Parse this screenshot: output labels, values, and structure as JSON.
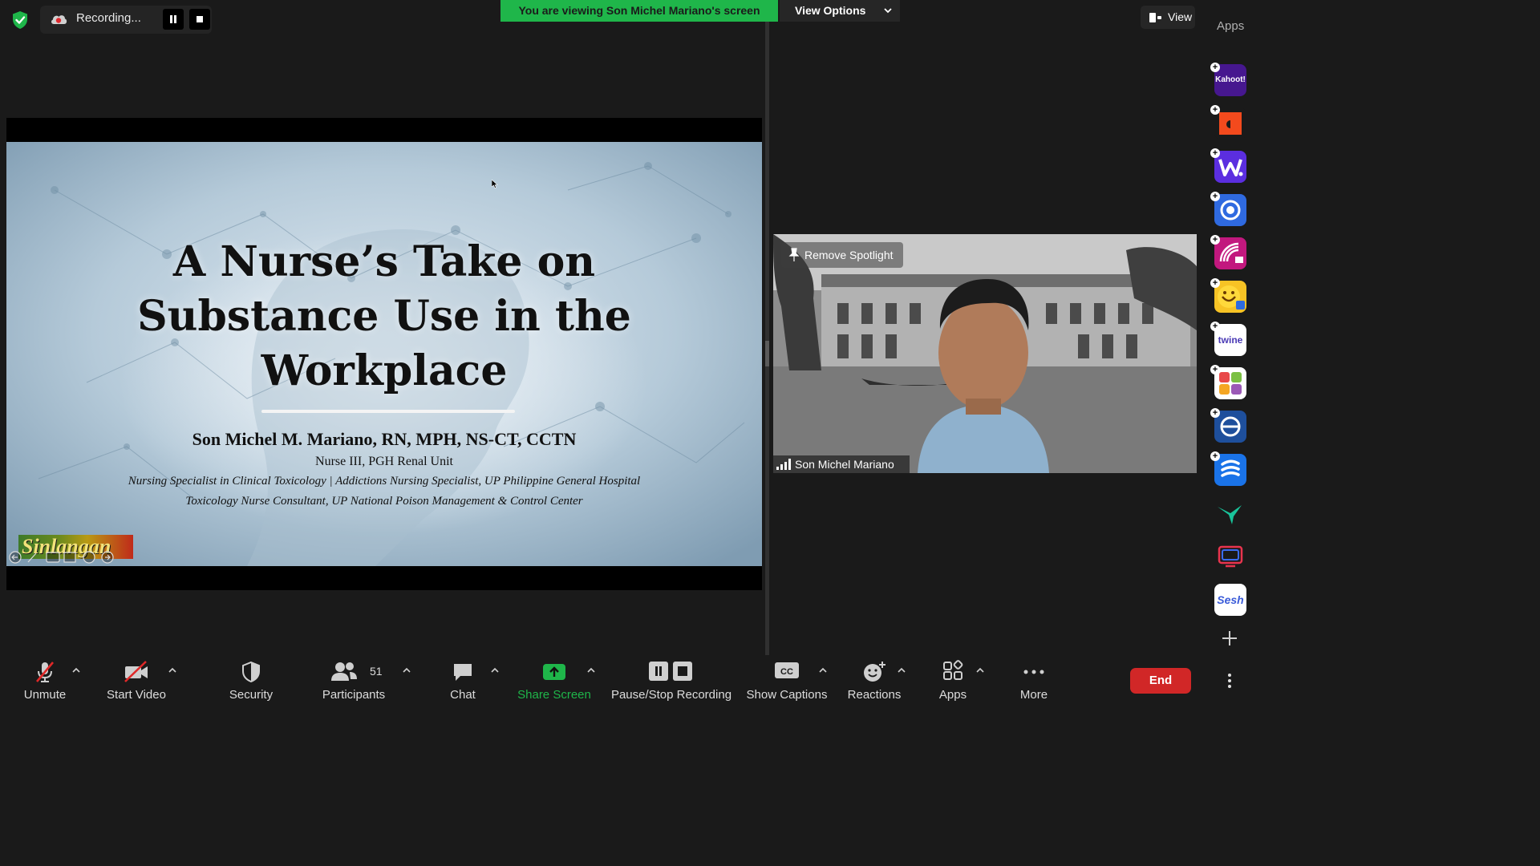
{
  "recording": {
    "label": "Recording..."
  },
  "banner": {
    "text": "You are viewing Son Michel Mariano's screen",
    "color": "#1fb64a"
  },
  "view_options": {
    "label": "View Options"
  },
  "view_button": {
    "label": "View"
  },
  "apps_sidebar": {
    "title": "Apps",
    "items": [
      {
        "name": "Kahoot!",
        "label": "Kahoot!"
      },
      {
        "name": "orange-app"
      },
      {
        "name": "wordwall-app"
      },
      {
        "name": "blue-circle-app"
      },
      {
        "name": "magenta-app"
      },
      {
        "name": "emoji-app"
      },
      {
        "name": "Twine",
        "label": "twine"
      },
      {
        "name": "colorful-grid-app"
      },
      {
        "name": "sync-app"
      },
      {
        "name": "slides-app"
      },
      {
        "name": "hummingbird-app"
      },
      {
        "name": "chat-screen-app"
      },
      {
        "name": "Sesh",
        "label": "Sesh"
      }
    ]
  },
  "slide": {
    "title_lines": [
      "A Nurse’s Take on",
      "Substance Use in the",
      "Workplace"
    ],
    "author": "Son Michel M. Mariano, RN, MPH, NS-CT, CCTN",
    "role": "Nurse III, PGH Renal Unit",
    "specialty": "Nursing Specialist in Clinical Toxicology | Addictions Nursing Specialist, UP Philippine General Hospital",
    "consultant": "Toxicology Nurse Consultant, UP National Poison Management & Control Center",
    "logo_text": "Sinlangan"
  },
  "video_tile": {
    "spotlight_label": "Remove Spotlight",
    "participant_name": "Son Michel Mariano"
  },
  "toolbar": {
    "unmute": "Unmute",
    "start_video": "Start Video",
    "security": "Security",
    "participants": "Participants",
    "participants_count": "51",
    "chat": "Chat",
    "share_screen": "Share Screen",
    "pause_stop_recording": "Pause/Stop Recording",
    "show_captions": "Show Captions",
    "reactions": "Reactions",
    "apps": "Apps",
    "more": "More",
    "end": "End",
    "share_color": "#1fb64a",
    "end_color": "#d12727"
  }
}
